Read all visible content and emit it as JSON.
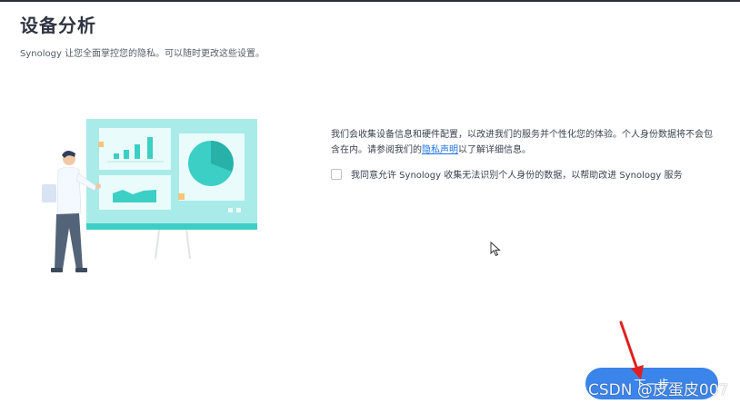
{
  "page": {
    "title": "设备分析",
    "subtitle": "Synology 让您全面掌控您的隐私。可以随时更改这些设置。"
  },
  "description": {
    "text_before_link": "我们会收集设备信息和硬件配置，以改进我们的服务并个性化您的体验。个人身份数据将不会包含在内。请参阅我们的",
    "link_text": "隐私声明",
    "text_after_link": "以了解详细信息。"
  },
  "consent": {
    "checked": false,
    "label": "我同意允许 Synology 收集无法识别个人身份的数据，以帮助改进 Synology 服务"
  },
  "footer": {
    "next_button_label": "下一步",
    "watermark": "CSDN @皮蛋皮007"
  },
  "colors": {
    "accent": "#3a84ea",
    "link": "#1a73e8",
    "board_teal": "#a8ebe8",
    "chart_teal": "#3ccfc5",
    "annotation_arrow": "#e02020"
  },
  "icons": {
    "cursor": "mouse-pointer-icon",
    "arrow": "red-arrow-annotation"
  }
}
